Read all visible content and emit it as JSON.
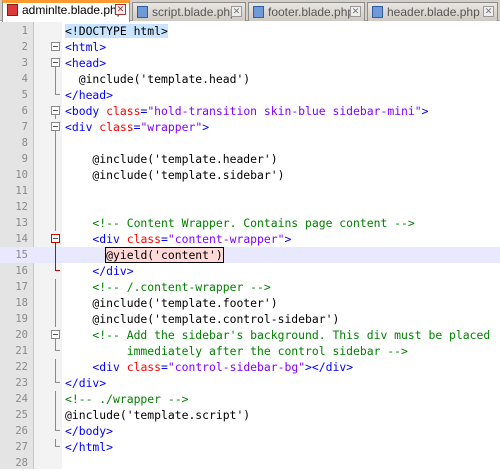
{
  "tabs": [
    {
      "label": "adminlte.blade.php",
      "active": true
    },
    {
      "label": "script.blade.php",
      "active": false
    },
    {
      "label": "footer.blade.php",
      "active": false
    },
    {
      "label": "header.blade.php",
      "active": false
    }
  ],
  "colors": {
    "tag": "#0000ff",
    "attribute": "#ff0000",
    "value": "#8000ff",
    "comment": "#008000",
    "plain": "#000000",
    "active_tab_accent": "#ff9a2e",
    "current_line": "#e8e8ff"
  },
  "current_line": 15,
  "lines": [
    {
      "n": "1",
      "tokens": [
        [
          "hl",
          "<!DOCTYPE html>"
        ]
      ]
    },
    {
      "n": "2",
      "tokens": [
        [
          "tag",
          "<html>"
        ]
      ]
    },
    {
      "n": "3",
      "tokens": [
        [
          "tag",
          "<head>"
        ]
      ]
    },
    {
      "n": "4",
      "tokens": [
        [
          "plain",
          "  @include('template.head')"
        ]
      ]
    },
    {
      "n": "5",
      "tokens": [
        [
          "tag",
          "</head>"
        ]
      ]
    },
    {
      "n": "6",
      "tokens": [
        [
          "tag",
          "<body "
        ],
        [
          "attr",
          "class"
        ],
        [
          "tag",
          "="
        ],
        [
          "val",
          "\"hold-transition skin-blue sidebar-mini\""
        ],
        [
          "tag",
          ">"
        ]
      ]
    },
    {
      "n": "7",
      "tokens": [
        [
          "tag",
          "<div "
        ],
        [
          "attr",
          "class"
        ],
        [
          "tag",
          "="
        ],
        [
          "val",
          "\"wrapper\""
        ],
        [
          "tag",
          ">"
        ]
      ]
    },
    {
      "n": "8",
      "tokens": []
    },
    {
      "n": "9",
      "tokens": [
        [
          "plain",
          "    @include('template.header')"
        ]
      ]
    },
    {
      "n": "10",
      "tokens": [
        [
          "plain",
          "    @include('template.sidebar')"
        ]
      ]
    },
    {
      "n": "11",
      "tokens": []
    },
    {
      "n": "12",
      "tokens": []
    },
    {
      "n": "13",
      "tokens": [
        [
          "cmt",
          "    <!-- Content Wrapper. Contains page content -->"
        ]
      ]
    },
    {
      "n": "14",
      "tokens": [
        [
          "tag",
          "    <div "
        ],
        [
          "attr",
          "class"
        ],
        [
          "tag",
          "="
        ],
        [
          "val",
          "\"content-wrapper\""
        ],
        [
          "tag",
          ">"
        ]
      ]
    },
    {
      "n": "15",
      "tokens": [
        [
          "plain",
          "      "
        ],
        [
          "yield",
          "@yield('content')"
        ]
      ]
    },
    {
      "n": "16",
      "tokens": [
        [
          "tag",
          "    </div>"
        ]
      ]
    },
    {
      "n": "17",
      "tokens": [
        [
          "cmt",
          "    <!-- /.content-wrapper -->"
        ]
      ]
    },
    {
      "n": "18",
      "tokens": [
        [
          "plain",
          "    @include('template.footer')"
        ]
      ]
    },
    {
      "n": "19",
      "tokens": [
        [
          "plain",
          "    @include('template.control-sidebar')"
        ]
      ]
    },
    {
      "n": "20",
      "tokens": [
        [
          "cmt",
          "    <!-- Add the sidebar's background. This div must be placed"
        ]
      ]
    },
    {
      "n": "21",
      "tokens": [
        [
          "cmt",
          "         immediately after the control sidebar -->"
        ]
      ]
    },
    {
      "n": "22",
      "tokens": [
        [
          "tag",
          "    <div "
        ],
        [
          "attr",
          "class"
        ],
        [
          "tag",
          "="
        ],
        [
          "val",
          "\"control-sidebar-bg\""
        ],
        [
          "tag",
          "></div>"
        ]
      ]
    },
    {
      "n": "23",
      "tokens": [
        [
          "tag",
          "</div>"
        ]
      ]
    },
    {
      "n": "24",
      "tokens": [
        [
          "cmt",
          "<!-- ./wrapper -->"
        ]
      ]
    },
    {
      "n": "25",
      "tokens": [
        [
          "plain",
          "@include('template.script')"
        ]
      ]
    },
    {
      "n": "26",
      "tokens": [
        [
          "tag",
          "</body>"
        ]
      ]
    },
    {
      "n": "27",
      "tokens": [
        [
          "tag",
          "</html>"
        ]
      ]
    },
    {
      "n": "28",
      "tokens": []
    }
  ]
}
